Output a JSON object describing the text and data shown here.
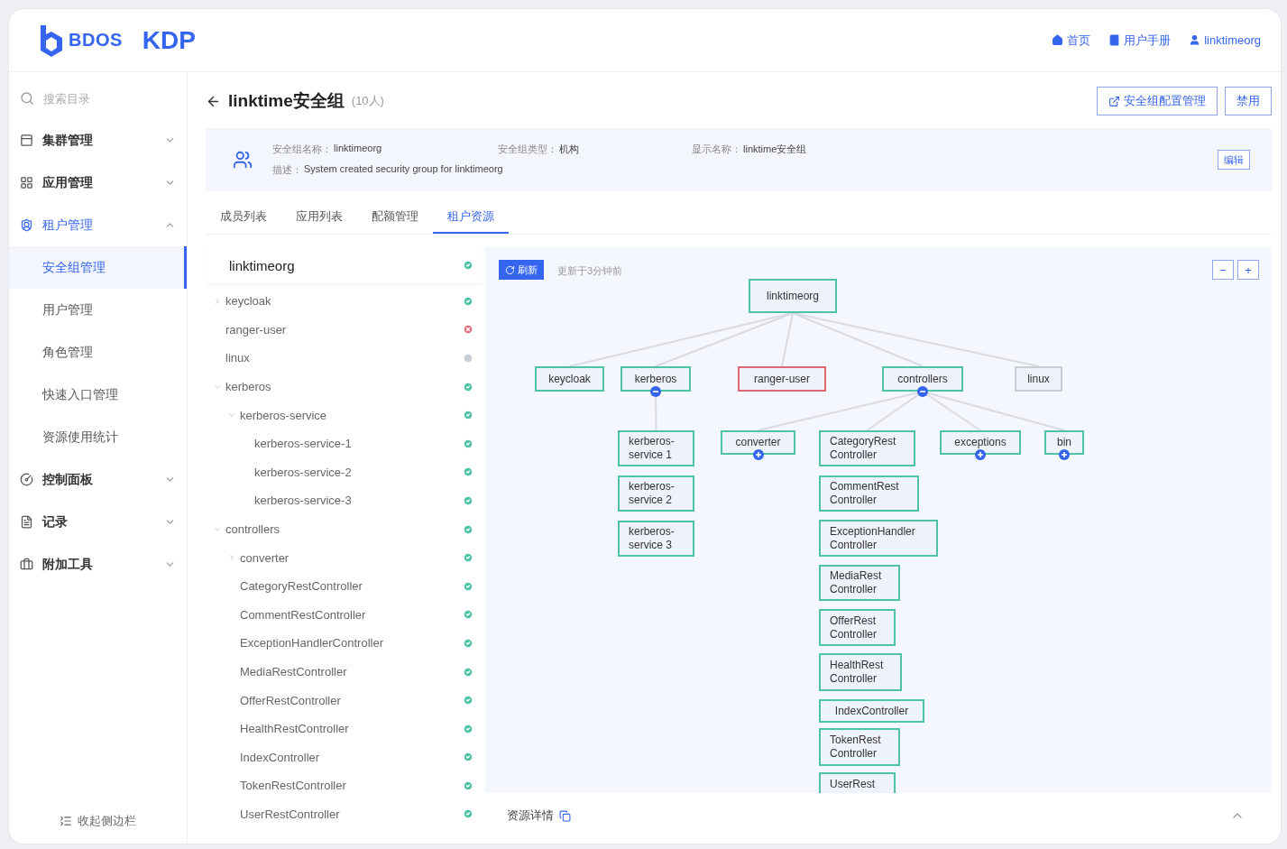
{
  "header": {
    "brand": "BDOS",
    "product": "KDP",
    "links": [
      {
        "label": "首页"
      },
      {
        "label": "用户手册"
      },
      {
        "label": "linktimeorg"
      }
    ]
  },
  "sidebar": {
    "search_placeholder": "搜索目录",
    "items": [
      {
        "label": "集群管理",
        "expanded": false
      },
      {
        "label": "应用管理",
        "expanded": false
      },
      {
        "label": "租户管理",
        "expanded": true,
        "children": [
          {
            "label": "安全组管理",
            "selected": true
          },
          {
            "label": "用户管理",
            "selected": false
          },
          {
            "label": "角色管理",
            "selected": false
          },
          {
            "label": "快速入口管理",
            "selected": false
          },
          {
            "label": "资源使用统计",
            "selected": false
          }
        ]
      },
      {
        "label": "控制面板",
        "expanded": false
      },
      {
        "label": "记录",
        "expanded": false
      },
      {
        "label": "附加工具",
        "expanded": false
      }
    ],
    "collapse": "收起侧边栏"
  },
  "page": {
    "title": "linktime安全组",
    "count": "(10人)",
    "actions": [
      {
        "label": "安全组配置管理"
      },
      {
        "label": "禁用"
      }
    ]
  },
  "info": {
    "fields": [
      {
        "label": "安全组名称：",
        "value": "linktimeorg"
      },
      {
        "label": "安全组类型：",
        "value": "机构"
      },
      {
        "label": "显示名称：",
        "value": "linktime安全组"
      },
      {
        "label": "描述：",
        "value": "System created security group for linktimeorg"
      }
    ],
    "edit": "编辑"
  },
  "tabs": [
    {
      "label": "成员列表",
      "selected": false
    },
    {
      "label": "应用列表",
      "selected": false
    },
    {
      "label": "配额管理",
      "selected": false
    },
    {
      "label": "租户资源",
      "selected": true
    }
  ],
  "resource_tree": {
    "root": {
      "label": "linktimeorg",
      "kind": "ok",
      "children": [
        {
          "label": "keycloak",
          "kind": "ok",
          "expanded": false
        },
        {
          "label": "ranger-user",
          "kind": "error"
        },
        {
          "label": "linux",
          "kind": "unknown"
        },
        {
          "label": "kerberos",
          "kind": "ok",
          "expanded": true,
          "children": [
            {
              "label": "kerberos-service",
              "kind": "ok",
              "expanded": true,
              "children": [
                {
                  "label": "kerberos-service-1",
                  "kind": "ok"
                },
                {
                  "label": "kerberos-service-2",
                  "kind": "ok"
                },
                {
                  "label": "kerberos-service-3",
                  "kind": "ok"
                }
              ]
            }
          ]
        },
        {
          "label": "controllers",
          "kind": "ok",
          "expanded": true,
          "children": [
            {
              "label": "converter",
              "kind": "ok",
              "expanded": false
            },
            {
              "label": "CategoryRestController",
              "kind": "ok"
            },
            {
              "label": "CommentRestController",
              "kind": "ok"
            },
            {
              "label": "ExceptionHandlerController",
              "kind": "ok"
            },
            {
              "label": "MediaRestController",
              "kind": "ok"
            },
            {
              "label": "OfferRestController",
              "kind": "ok"
            },
            {
              "label": "HealthRestController",
              "kind": "ok"
            },
            {
              "label": "IndexController",
              "kind": "ok"
            },
            {
              "label": "TokenRestController",
              "kind": "ok"
            },
            {
              "label": "UserRestController",
              "kind": "ok"
            }
          ]
        }
      ]
    }
  },
  "graph": {
    "refresh": "刷新",
    "updated": "更新于3分钟前",
    "zoom_out": "−",
    "zoom_in": "+",
    "root": {
      "lines": [
        "linktimeorg"
      ],
      "kind": "ok",
      "children": [
        {
          "lines": [
            "keycloak"
          ],
          "kind": "ok"
        },
        {
          "lines": [
            "kerberos"
          ],
          "kind": "ok",
          "expanded": true,
          "children": [
            {
              "lines": [
                "kerberos-",
                "service 1"
              ],
              "kind": "ok"
            },
            {
              "lines": [
                "kerberos-",
                "service 2"
              ],
              "kind": "ok"
            },
            {
              "lines": [
                "kerberos-",
                "service 3"
              ],
              "kind": "ok"
            }
          ]
        },
        {
          "lines": [
            "ranger-user"
          ],
          "kind": "error"
        },
        {
          "lines": [
            "controllers"
          ],
          "kind": "ok",
          "expanded": true,
          "children": [
            {
              "lines": [
                "converter"
              ],
              "kind": "ok",
              "expanded": false
            },
            {
              "lines": [
                "CategoryRest",
                "Controller"
              ],
              "kind": "ok"
            },
            {
              "lines": [
                "CommentRest",
                "Controller"
              ],
              "kind": "ok"
            },
            {
              "lines": [
                "ExceptionHandler",
                "Controller"
              ],
              "kind": "ok"
            },
            {
              "lines": [
                "MediaRest",
                "Controller"
              ],
              "kind": "ok"
            },
            {
              "lines": [
                "OfferRest",
                "Controller"
              ],
              "kind": "ok"
            },
            {
              "lines": [
                "HealthRest",
                "Controller"
              ],
              "kind": "ok"
            },
            {
              "lines": [
                "IndexController"
              ],
              "kind": "ok"
            },
            {
              "lines": [
                "TokenRest",
                "Controller"
              ],
              "kind": "ok"
            },
            {
              "lines": [
                "UserRest"
              ],
              "kind": "ok"
            },
            {
              "lines": [
                "exceptions"
              ],
              "kind": "ok",
              "expanded": false
            },
            {
              "lines": [
                "bin"
              ],
              "kind": "ok",
              "expanded": false
            }
          ]
        },
        {
          "lines": [
            "linux"
          ],
          "kind": "unknown"
        }
      ]
    }
  },
  "details": {
    "title": "资源详情",
    "expanded": false
  }
}
